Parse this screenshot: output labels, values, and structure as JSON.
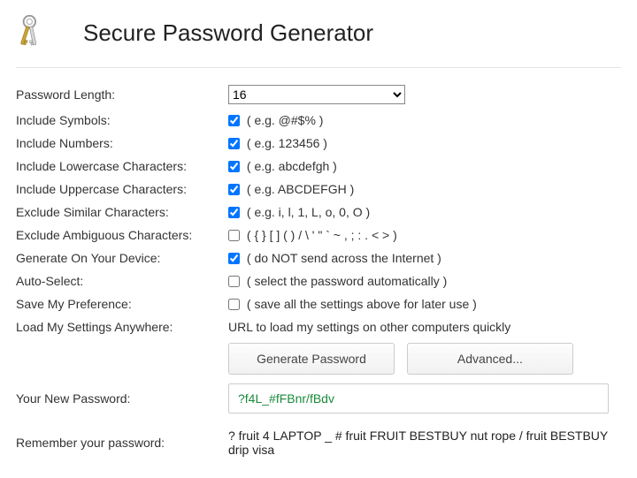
{
  "header": {
    "title": "Secure Password Generator"
  },
  "labels": {
    "length": "Password Length:",
    "symbols": "Include Symbols:",
    "numbers": "Include Numbers:",
    "lower": "Include Lowercase Characters:",
    "upper": "Include Uppercase Characters:",
    "similar": "Exclude Similar Characters:",
    "ambiguous": "Exclude Ambiguous Characters:",
    "device": "Generate On Your Device:",
    "autoselect": "Auto-Select:",
    "savepref": "Save My Preference:",
    "loadany": "Load My Settings Anywhere:",
    "newpw": "Your New Password:",
    "remember": "Remember your password:"
  },
  "helpers": {
    "symbols": "( e.g. @#$% )",
    "numbers": "( e.g. 123456 )",
    "lower": "( e.g. abcdefgh )",
    "upper": "( e.g. ABCDEFGH )",
    "similar": "( e.g. i, l, 1, L, o, 0, O )",
    "ambiguous": "( { } [ ] ( ) / \\ ' \" ` ~ , ; : . < > )",
    "device": "( do NOT send across the Internet )",
    "autoselect": "( select the password automatically )",
    "savepref": "( save all the settings above for later use )",
    "loadany": "URL to load my settings on other computers quickly"
  },
  "values": {
    "length": "16",
    "symbols": true,
    "numbers": true,
    "lower": true,
    "upper": true,
    "similar": true,
    "ambiguous": false,
    "device": true,
    "autoselect": false,
    "savepref": false
  },
  "buttons": {
    "generate": "Generate Password",
    "advanced": "Advanced..."
  },
  "output": {
    "password": "?f4L_#fFBnr/fBdv",
    "mnemonic": "? fruit 4 LAPTOP _ # fruit FRUIT BESTBUY nut rope / fruit BESTBUY drip visa"
  }
}
